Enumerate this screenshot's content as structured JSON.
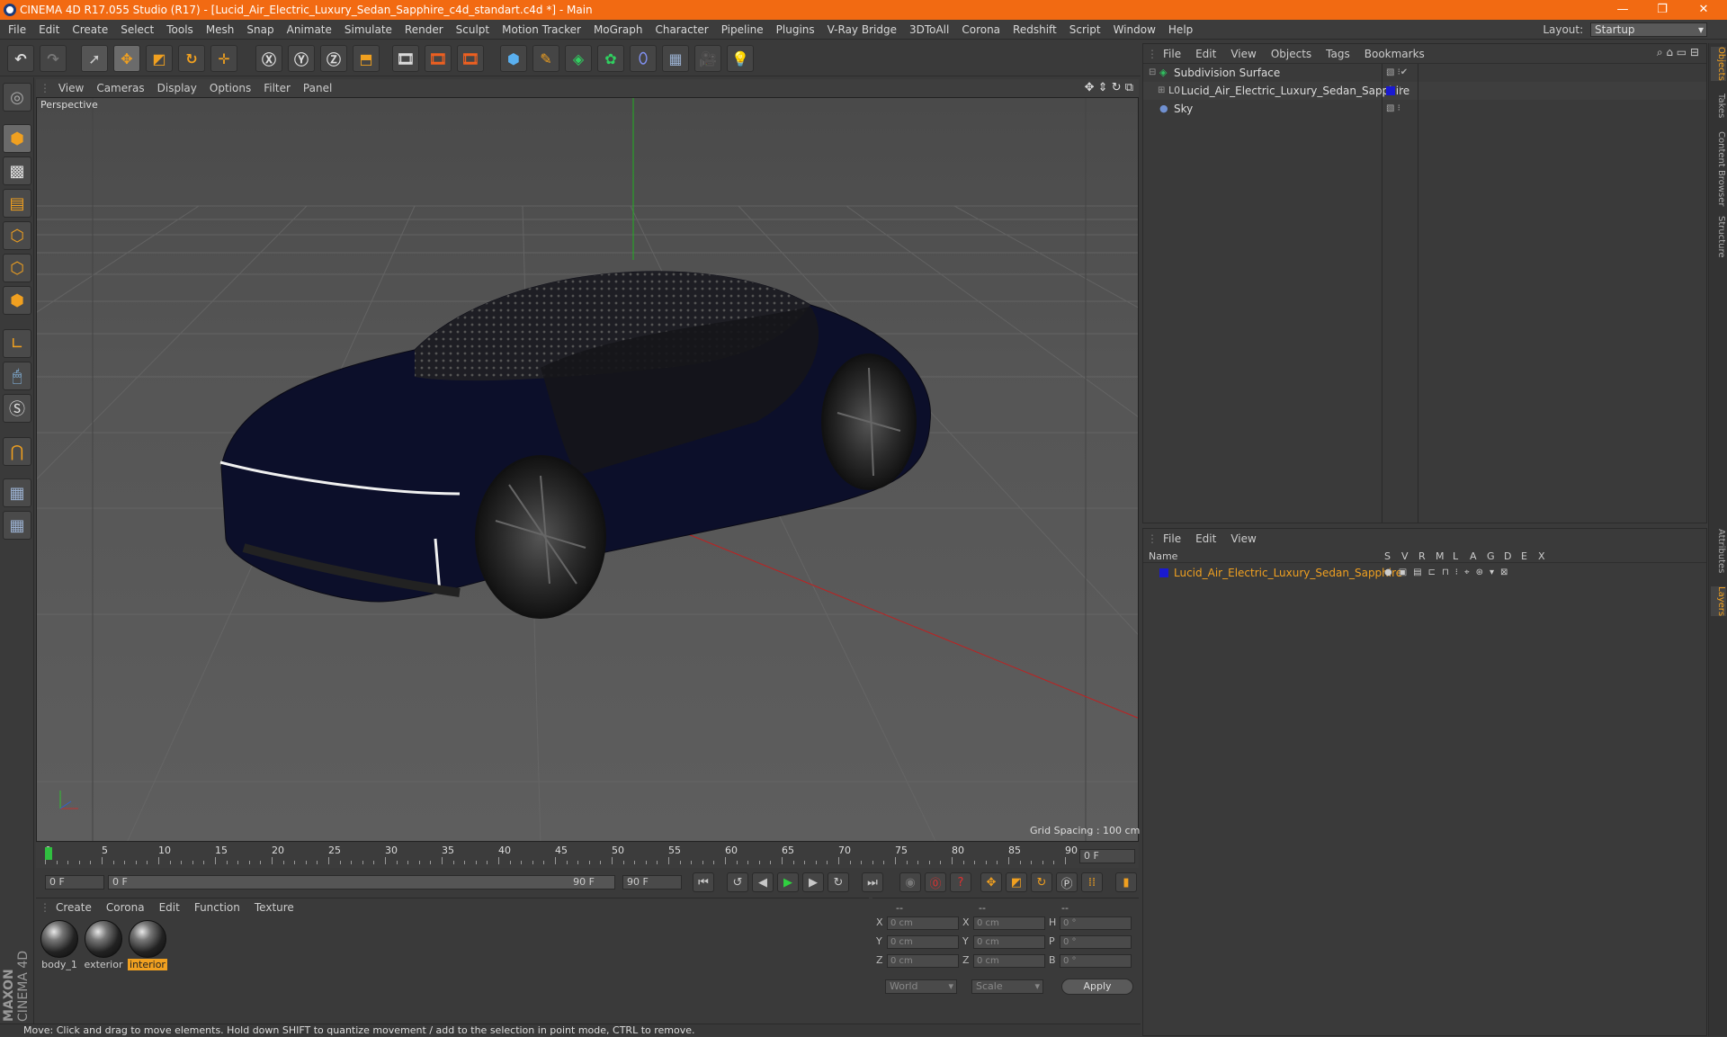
{
  "window": {
    "title": "CINEMA 4D R17.055 Studio (R17) - [Lucid_Air_Electric_Luxury_Sedan_Sapphire_c4d_standart.c4d *] - Main",
    "minimize": "—",
    "maximize": "❐",
    "close": "✕"
  },
  "menu": [
    "File",
    "Edit",
    "Create",
    "Select",
    "Tools",
    "Mesh",
    "Snap",
    "Animate",
    "Simulate",
    "Render",
    "Sculpt",
    "Motion Tracker",
    "MoGraph",
    "Character",
    "Pipeline",
    "Plugins",
    "V-Ray Bridge",
    "3DToAll",
    "Corona",
    "Redshift",
    "Script",
    "Window",
    "Help"
  ],
  "layout": {
    "label": "Layout:",
    "value": "Startup"
  },
  "viewport": {
    "menu": [
      "View",
      "Cameras",
      "Display",
      "Options",
      "Filter",
      "Panel"
    ],
    "label": "Perspective",
    "grid_spacing": "Grid Spacing : 100 cm"
  },
  "timeline": {
    "ticks": [
      "0",
      "5",
      "10",
      "15",
      "20",
      "25",
      "30",
      "35",
      "40",
      "45",
      "50",
      "55",
      "60",
      "65",
      "70",
      "75",
      "80",
      "85",
      "90"
    ],
    "current_frame": "0 F"
  },
  "transport": {
    "start": "0 F",
    "range_start": "0 F",
    "range_end": "90 F",
    "end": "90 F"
  },
  "materials": {
    "menu": [
      "Create",
      "Corona",
      "Edit",
      "Function",
      "Texture"
    ],
    "items": [
      {
        "name": "body_1",
        "selected": false
      },
      {
        "name": "exterior",
        "selected": false
      },
      {
        "name": "interior",
        "selected": true
      }
    ]
  },
  "attributes": {
    "headers": [
      "--",
      "--",
      "--"
    ],
    "rows": [
      {
        "a": "X",
        "av": "0 cm",
        "b": "X",
        "bv": "0 cm",
        "c": "H",
        "cv": "0 °"
      },
      {
        "a": "Y",
        "av": "0 cm",
        "b": "Y",
        "bv": "0 cm",
        "c": "P",
        "cv": "0 °"
      },
      {
        "a": "Z",
        "av": "0 cm",
        "b": "Z",
        "bv": "0 cm",
        "c": "B",
        "cv": "0 °"
      }
    ],
    "coord_mode": "World",
    "size_mode": "Scale",
    "apply": "Apply"
  },
  "status": "Move: Click and drag to move elements. Hold down SHIFT to quantize movement / add to the selection in point mode, CTRL to remove.",
  "objects": {
    "menu": [
      "File",
      "Edit",
      "View",
      "Objects",
      "Tags",
      "Bookmarks"
    ],
    "items": [
      "Subdivision Surface",
      "Lucid_Air_Electric_Luxury_Sedan_Sapphire",
      "Sky"
    ]
  },
  "layers": {
    "menu": [
      "File",
      "Edit",
      "View"
    ],
    "columns": {
      "name": "Name",
      "flags": [
        "S",
        "V",
        "R",
        "M",
        "L",
        "A",
        "G",
        "D",
        "E",
        "X"
      ]
    },
    "items": [
      "Lucid_Air_Electric_Luxury_Sedan_Sapphire"
    ]
  },
  "side_tabs": [
    "Objects",
    "Takes",
    "Content Browser",
    "Structure",
    "Attributes",
    "Layers"
  ],
  "brand": {
    "maxon": "MAXON",
    "c4d": "CINEMA 4D"
  },
  "colors": {
    "titlebar": "#f26a12",
    "selected_text": "#f0a020",
    "layer_color": "#1a1ad0"
  },
  "icons": {
    "undo": "undo-icon",
    "redo": "redo-icon",
    "select": "arrow-icon",
    "move": "move-icon",
    "scale": "scale-icon",
    "rotate": "rotate-icon"
  }
}
